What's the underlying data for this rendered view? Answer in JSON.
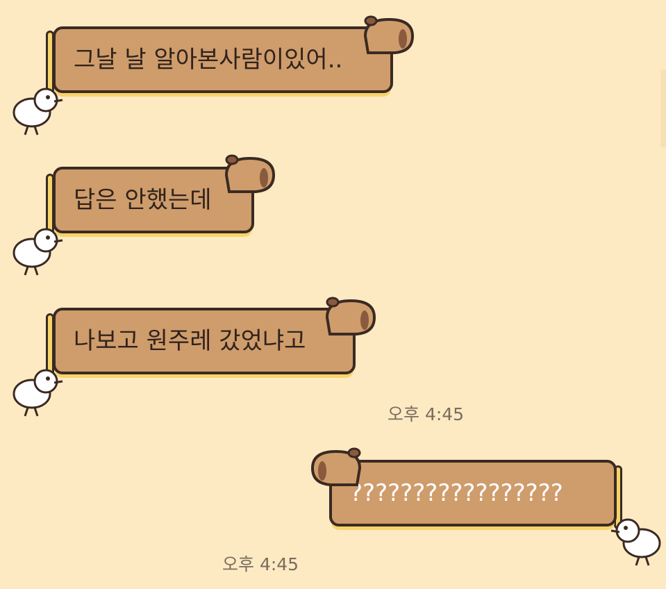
{
  "messages": [
    {
      "id": 1,
      "direction": "incoming",
      "text": "그날 날 알아본사람이있어.."
    },
    {
      "id": 2,
      "direction": "incoming",
      "text": "답은 안했는데"
    },
    {
      "id": 3,
      "direction": "incoming",
      "text": "나보고 원주레 갔었냐고",
      "timestamp": "오후 4:45"
    },
    {
      "id": 4,
      "direction": "outgoing",
      "text": "?????????????????",
      "timestamp": "오후 4:45"
    }
  ],
  "colors": {
    "background": "#fdeac3",
    "bubble_fill": "#cf9c6c",
    "bubble_outline": "#3a2a22",
    "accent_strip": "#f7d36b",
    "timestamp_text": "#7a6c5d"
  },
  "icons": {
    "bubble_decoration": "capybara-head-icon",
    "sender_decoration": "kiwi-bird-icon"
  }
}
